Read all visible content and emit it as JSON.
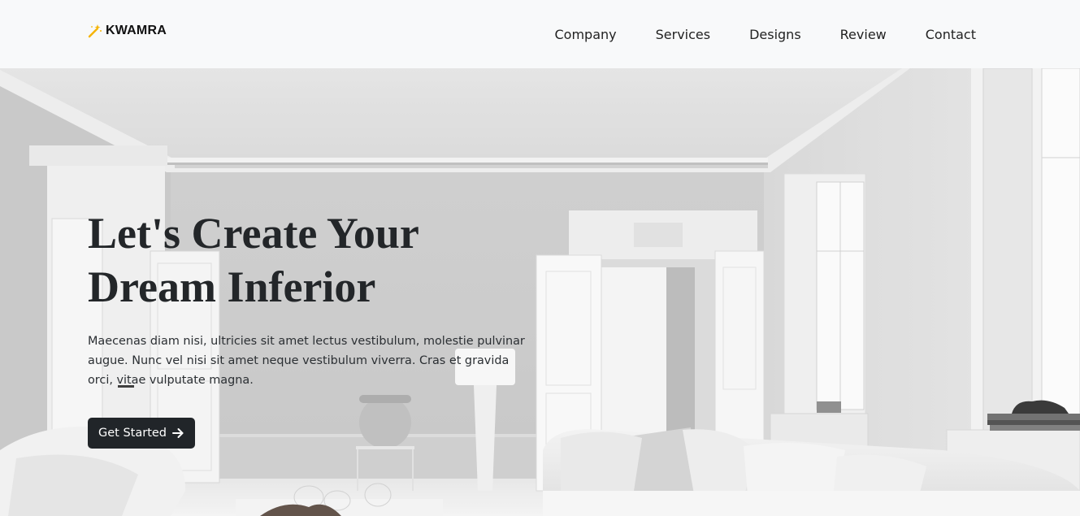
{
  "brand": {
    "name": "KWAMRA",
    "icon": "magic-wand-icon",
    "icon_color": "#f5b400"
  },
  "nav": {
    "items": [
      {
        "label": "Company"
      },
      {
        "label": "Services"
      },
      {
        "label": "Designs"
      },
      {
        "label": "Review"
      },
      {
        "label": "Contact"
      }
    ]
  },
  "hero": {
    "title": "Let's Create Your Dream Inferior",
    "text": "Maecenas diam nisi, ultricies sit amet lectus vestibulum, molestie pulvinar augue. Nunc vel nisi sit amet neque vestibulum viverra. Cras et gravida orci, vitae vulputate magna.",
    "button_label": "Get Started",
    "button_icon": "arrow-right-icon",
    "background": "white-living-room-photo"
  },
  "colors": {
    "navbar_bg": "#f8f9fa",
    "button_bg": "#212529",
    "title_color": "#232629"
  }
}
